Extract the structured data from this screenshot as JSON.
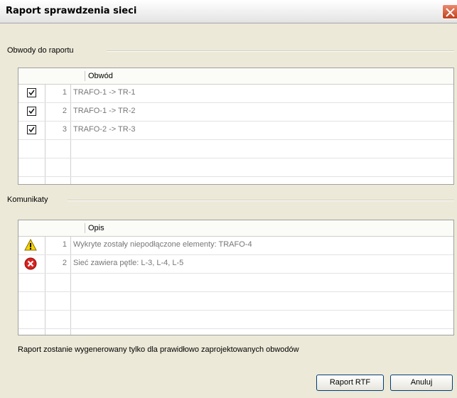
{
  "window": {
    "title": "Raport sprawdzenia sieci"
  },
  "circuits_group": {
    "label": "Obwody do raportu",
    "column_header": "Obwód",
    "rows": [
      {
        "checked": true,
        "num": "1",
        "name": "TRAFO-1 -> TR-1"
      },
      {
        "checked": true,
        "num": "2",
        "name": "TRAFO-1 -> TR-2"
      },
      {
        "checked": true,
        "num": "3",
        "name": "TRAFO-2 -> TR-3"
      }
    ]
  },
  "messages_group": {
    "label": "Komunikaty",
    "column_header": "Opis",
    "rows": [
      {
        "icon": "warning-icon",
        "num": "1",
        "text": "Wykryte zostały niepodłączone elementy: TRAFO-4"
      },
      {
        "icon": "error-icon",
        "num": "2",
        "text": "Sieć zawiera pętle:  L-3, L-4, L-5"
      }
    ]
  },
  "footer": {
    "note": "Raport zostanie wygenerowany tylko dla prawidłowo zaprojektowanych obwodów",
    "rtf_button": "Raport RTF",
    "cancel_button": "Anuluj"
  },
  "colors": {
    "warning": "#f5d300",
    "error": "#d9231f",
    "close": "#d9531e"
  }
}
